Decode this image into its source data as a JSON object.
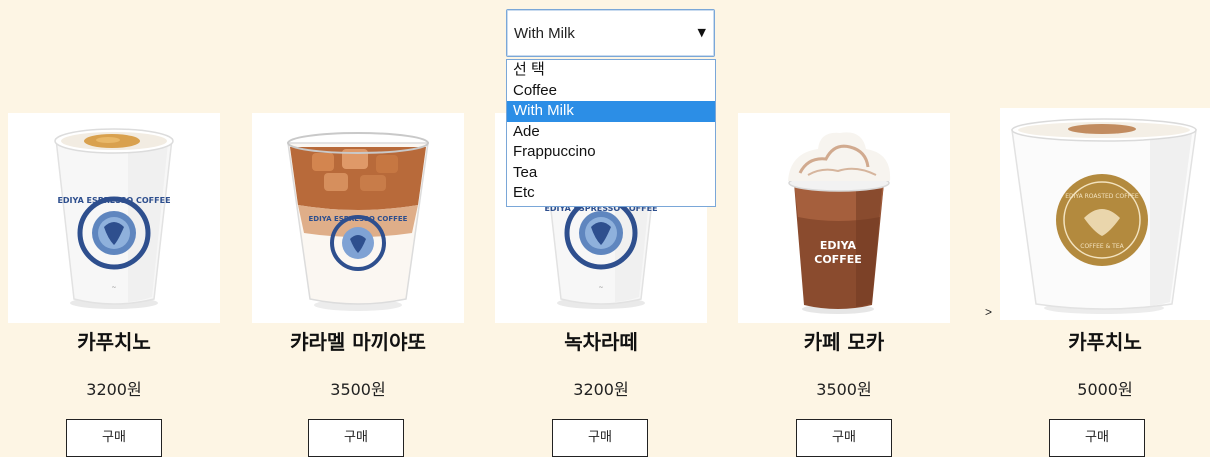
{
  "category_select": {
    "selected": "With Milk",
    "options": [
      "선 택",
      "Coffee",
      "With Milk",
      "Ade",
      "Frappuccino",
      "Tea",
      "Etc"
    ]
  },
  "products": [
    {
      "name": "카푸치노",
      "price": "3200원",
      "buy_label": "구매",
      "image": "cappuccino-cup",
      "cup_text": "EDIYA ESPRESSO COFFEE"
    },
    {
      "name": "캬라멜 마끼야또",
      "price": "3500원",
      "buy_label": "구매",
      "image": "iced-caramel-macchiato",
      "cup_text": "EDIYA ESPRESSO COFFEE"
    },
    {
      "name": "녹차라떼",
      "price": "3200원",
      "buy_label": "구매",
      "image": "green-tea-latte-cup",
      "cup_text": "EDIYA ESPRESSO COFFEE"
    },
    {
      "name": "카페 모카",
      "price": "3500원",
      "buy_label": "구매",
      "image": "cafe-mocha-whipped",
      "cup_text": "EDIYA COFFEE"
    },
    {
      "name": "카푸치노",
      "price": "5000원",
      "buy_label": "구매",
      "image": "cappuccino-gold-cup",
      "cup_text": "EDIYA ROASTED COFFEE"
    }
  ],
  "nav": {
    "next_label": ">"
  },
  "colors": {
    "background": "#fdf5e4",
    "select_highlight": "#2c8ee6",
    "select_border": "#7aa7d8"
  }
}
